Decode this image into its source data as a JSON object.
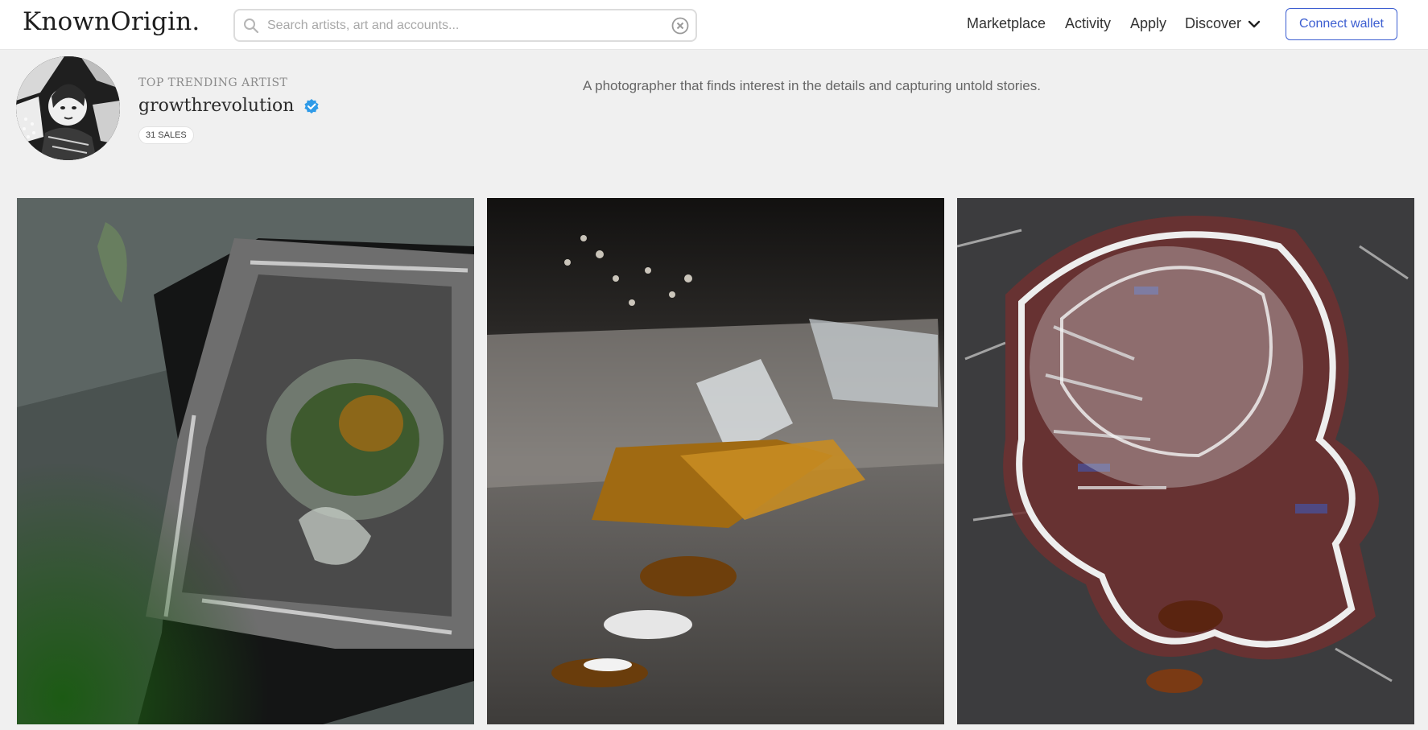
{
  "header": {
    "logo": "KnownOrigin.",
    "search_placeholder": "Search artists, art and accounts...",
    "nav": {
      "marketplace": "Marketplace",
      "activity": "Activity",
      "apply": "Apply",
      "discover": "Discover"
    },
    "connect_wallet": "Connect wallet"
  },
  "artist": {
    "eyebrow": "TOP TRENDING ARTIST",
    "name": "growthrevolution",
    "sales": "31 SALES",
    "bio": "A photographer that finds interest in the details and capturing untold stories.",
    "verified_color": "#2f9be8"
  },
  "gallery": {
    "artworks": [
      {
        "icon": "artwork-image"
      },
      {
        "icon": "artwork-image"
      },
      {
        "icon": "artwork-image"
      }
    ]
  },
  "colors": {
    "accent": "#3c5ed1",
    "background": "#f0f0f0"
  }
}
